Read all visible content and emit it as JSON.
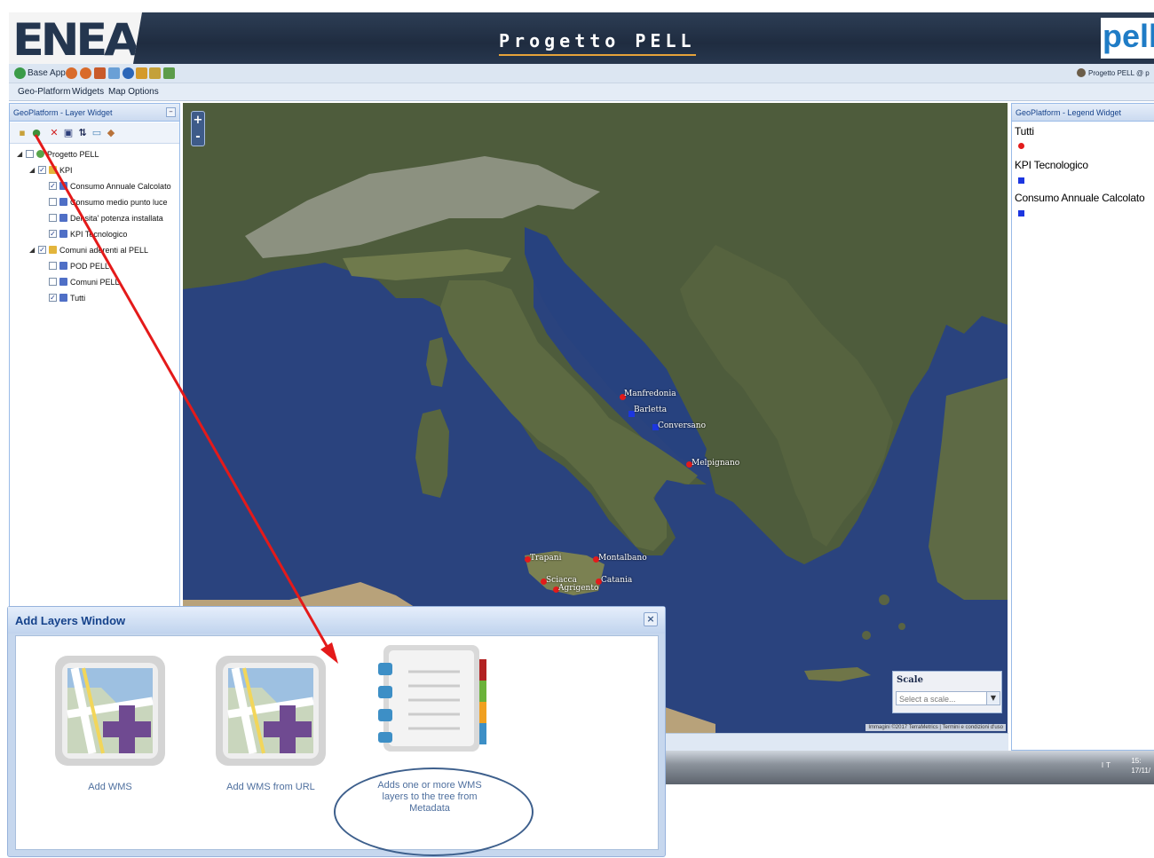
{
  "header": {
    "logo": "ENEA",
    "title": "Progetto PELL",
    "pell_logo": "pell"
  },
  "toolbar": {
    "base_app": "Base App",
    "user": "Progetto PELL @ p"
  },
  "menu": {
    "items": [
      "Geo-Platform",
      "Widgets",
      "Map Options"
    ]
  },
  "layer_widget": {
    "title": "GeoPlatform - Layer Widget",
    "tree": [
      {
        "label": "Progetto PELL",
        "checked": false
      },
      {
        "label": "KPI",
        "checked": true
      },
      {
        "label": "Consumo Annuale Calcolato",
        "checked": true
      },
      {
        "label": "Consumo medio punto luce",
        "checked": false
      },
      {
        "label": "Densita' potenza installata",
        "checked": false
      },
      {
        "label": "KPI Tecnologico",
        "checked": true
      },
      {
        "label": "Comuni aderenti al PELL",
        "checked": true
      },
      {
        "label": "POD PELL",
        "checked": false
      },
      {
        "label": "Comuni PELL",
        "checked": false
      },
      {
        "label": "Tutti",
        "checked": true
      }
    ]
  },
  "map": {
    "zoom_in": "+",
    "zoom_out": "-",
    "cities": [
      "Manfredonia",
      "Barletta",
      "Conversano",
      "Melpignano",
      "Trapani",
      "Montalbano",
      "Sciacca",
      "Agrigento",
      "Catania"
    ],
    "scale_label": "Scale",
    "scale_placeholder": "Select a scale...",
    "attribution": "Immagini ©2017 TerraMetrics | Termini e condizioni d'uso"
  },
  "legend_widget": {
    "title": "GeoPlatform - Legend Widget",
    "entries": [
      "Tutti",
      "KPI Tecnologico",
      "Consumo Annuale Calcolato"
    ]
  },
  "taskbar": {
    "tray": "IT",
    "time": "15:",
    "date": "17/11/"
  },
  "add_layers_window": {
    "title": "Add Layers Window",
    "close": "×",
    "options": [
      "Add WMS",
      "Add WMS from URL",
      "Adds one or more WMS layers to the tree from Metadata"
    ]
  },
  "colors": {
    "header_bg": "#24364f",
    "accent_orange": "#e6a33a",
    "pell_blue": "#1f7cc6",
    "panel_border": "#99bbe8",
    "marker_red": "#e21b1b",
    "marker_blue": "#1c36e0",
    "arrow_red": "#e41a1a"
  }
}
